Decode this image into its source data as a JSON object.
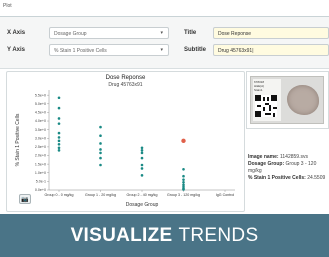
{
  "window": {
    "title": "Plot"
  },
  "controls": {
    "x_axis": {
      "label": "X Axis",
      "value": "Dosage Group"
    },
    "y_axis": {
      "label": "Y Axis",
      "value": "% Stain 1 Positive Cells"
    },
    "title": {
      "label": "Title",
      "value": "Dose Reponse"
    },
    "subtitle": {
      "label": "Subtitle",
      "value": "Drug 45763x91|"
    }
  },
  "chart_data": {
    "type": "scatter",
    "title": "Dose Reponse",
    "subtitle": "Drug 45763x91",
    "xlabel": "Dosage Group",
    "ylabel": "% Stain 1 Positive Cells",
    "categories": [
      "Group 0 - 0 mg/kg",
      "Group 1 - 20 mg/kg",
      "Group 2 - 40 mg/kg",
      "Group 3 - 120 mg/kg",
      "IgG Control"
    ],
    "y_ticks": [
      "0.0e+0",
      "5.0e-1",
      "1.0e+0",
      "1.5e+0",
      "2.0e+0",
      "2.5e+0",
      "3.0e+0",
      "3.5e+0",
      "4.0e+0",
      "4.5e+0",
      "5.0e+0",
      "5.5e+0"
    ],
    "ylim": [
      0,
      5.8
    ],
    "points": [
      {
        "x": 0,
        "y": 5.35
      },
      {
        "x": 0,
        "y": 4.75
      },
      {
        "x": 0,
        "y": 4.15
      },
      {
        "x": 0,
        "y": 3.85
      },
      {
        "x": 0,
        "y": 3.3
      },
      {
        "x": 0,
        "y": 3.05
      },
      {
        "x": 0,
        "y": 2.85
      },
      {
        "x": 0,
        "y": 2.65
      },
      {
        "x": 0,
        "y": 2.45
      },
      {
        "x": 0,
        "y": 2.3
      },
      {
        "x": 1,
        "y": 3.65
      },
      {
        "x": 1,
        "y": 3.15
      },
      {
        "x": 1,
        "y": 2.7
      },
      {
        "x": 1,
        "y": 2.35
      },
      {
        "x": 1,
        "y": 2.15
      },
      {
        "x": 1,
        "y": 1.85
      },
      {
        "x": 1,
        "y": 1.45
      },
      {
        "x": 2,
        "y": 2.45
      },
      {
        "x": 2,
        "y": 2.3
      },
      {
        "x": 2,
        "y": 2.15
      },
      {
        "x": 2,
        "y": 1.85
      },
      {
        "x": 2,
        "y": 1.45
      },
      {
        "x": 2,
        "y": 1.25
      },
      {
        "x": 2,
        "y": 0.85
      },
      {
        "x": 3,
        "y": 2.85,
        "highlight": true
      },
      {
        "x": 3,
        "y": 1.2
      },
      {
        "x": 3,
        "y": 0.8
      },
      {
        "x": 3,
        "y": 0.6
      },
      {
        "x": 3,
        "y": 0.45
      },
      {
        "x": 3,
        "y": 0.3
      },
      {
        "x": 3,
        "y": 0.18
      },
      {
        "x": 3,
        "y": 0.08
      },
      {
        "x": 3,
        "y": 0.03
      }
    ],
    "colors": {
      "point": "#1a8a85",
      "highlight": "#e0604a"
    },
    "grid": false,
    "legend": "none"
  },
  "slide": {
    "label_lines": [
      "678318",
      "H&E(A)",
      "Stain1"
    ]
  },
  "info": {
    "image_name_label": "Image name:",
    "image_name_value": "1142859.svs",
    "dosage_label": "Dosage Group:",
    "dosage_value": "Group 3 - 120 mg/kg",
    "stain_label": "% Stain 1 Positive Cells:",
    "stain_value": "24.5509"
  },
  "banner": {
    "bold": "VISUALIZE",
    "light": "TRENDS",
    "color": "#4a7487"
  }
}
